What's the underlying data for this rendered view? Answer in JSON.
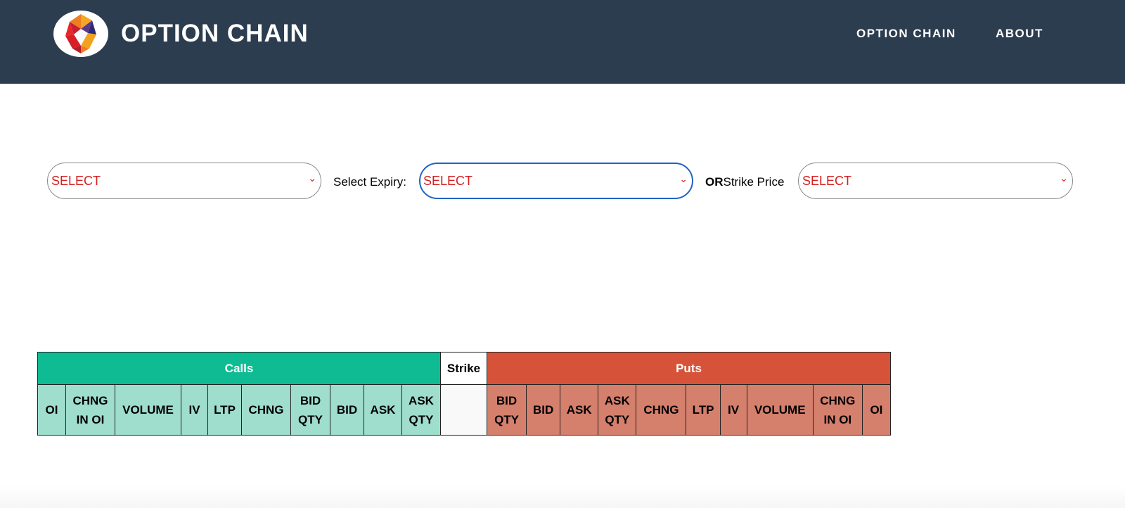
{
  "header": {
    "brand": "OPTION CHAIN",
    "logo_icon": "faceted-gem-logo",
    "nav": [
      "OPTION CHAIN",
      "ABOUT"
    ]
  },
  "filters": {
    "symbol": {
      "value": "SELECT"
    },
    "expiry": {
      "label": "Select Expiry:",
      "value": "SELECT"
    },
    "strike": {
      "label_bold": "OR",
      "label": "Strike Price",
      "value": "SELECT"
    }
  },
  "table": {
    "groups": {
      "calls": "Calls",
      "strike": "Strike",
      "puts": "Puts"
    },
    "call_columns": [
      "OI",
      "CHNG IN OI",
      "VOLUME",
      "IV",
      "LTP",
      "CHNG",
      "BID QTY",
      "BID",
      "ASK",
      "ASK QTY"
    ],
    "put_columns": [
      "BID QTY",
      "BID",
      "ASK",
      "ASK QTY",
      "CHNG",
      "LTP",
      "IV",
      "VOLUME",
      "CHNG IN OI",
      "OI"
    ]
  },
  "colors": {
    "header_bg": "#2c3d50",
    "calls": "#0fbb92",
    "calls_light": "#9fddcd",
    "puts": "#d6533a",
    "puts_light": "#d57f6d",
    "select_text": "#d42020",
    "focus_border": "#1f63c6"
  }
}
